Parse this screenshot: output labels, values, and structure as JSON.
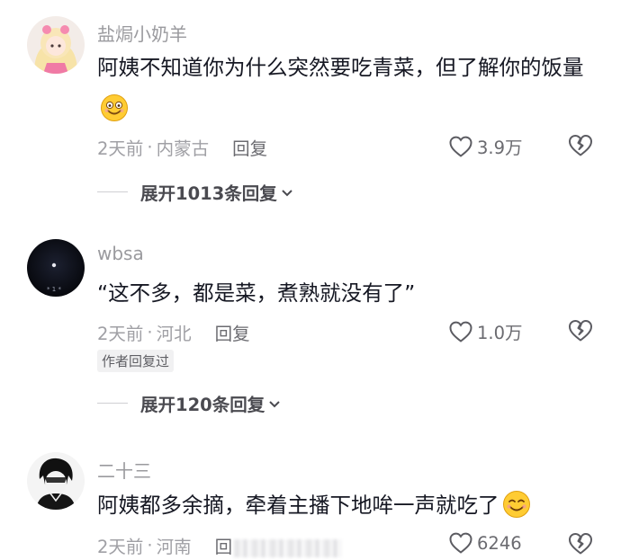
{
  "comments": [
    {
      "username": "盐焗小奶羊",
      "text": "阿姨不知道你为什么突然要吃青菜，但了解你的饭量",
      "emoji": "smile-emoji",
      "time": "2天前",
      "separator": "·",
      "location": "内蒙古",
      "reply_label": "回复",
      "likes": "3.9万",
      "expand_label": "展开1013条回复"
    },
    {
      "username": "wbsa",
      "text": "“这不多，都是菜，煮熟就没有了”",
      "time": "2天前",
      "separator": "·",
      "location": "河北",
      "reply_label": "回复",
      "likes": "1.0万",
      "badge": "作者回复过",
      "expand_label": "展开120条回复"
    },
    {
      "username": "二十三",
      "text": "阿姨都多余摘，牵着主播下地哞一声就吃了",
      "emoji": "smile-emoji",
      "time": "2天前",
      "separator": "·",
      "location": "河南",
      "reply_label": "回",
      "likes": "6246"
    }
  ],
  "colors": {
    "text_primary": "#161823",
    "text_secondary": "#a0a0a5",
    "emoji_yellow": "#ffcc33"
  },
  "icons": [
    "heart-outline-icon",
    "broken-heart-icon",
    "chevron-down-icon"
  ]
}
